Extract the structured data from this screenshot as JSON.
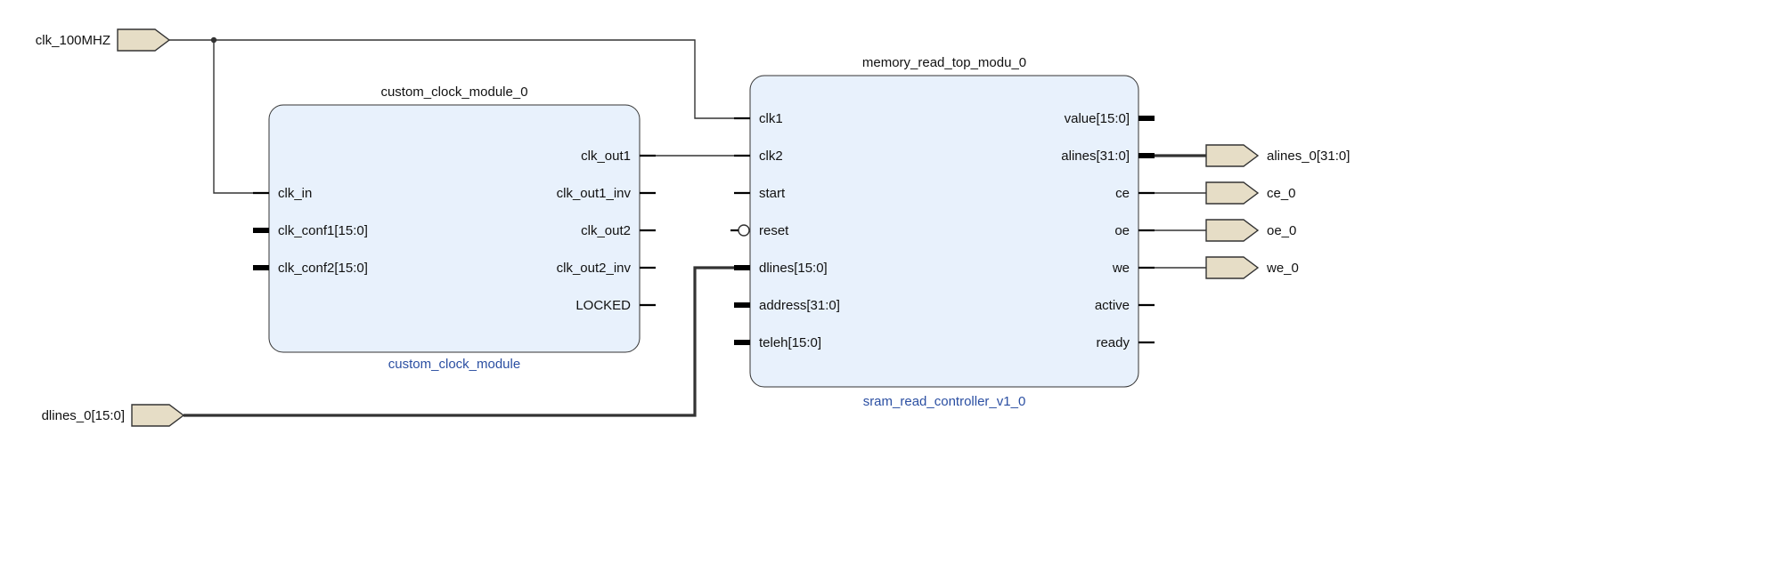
{
  "external_ports": {
    "clk_100mhz": "clk_100MHZ",
    "dlines_in": "dlines_0[15:0]",
    "alines_out": "alines_0[31:0]",
    "ce_out": "ce_0",
    "oe_out": "oe_0",
    "we_out": "we_0"
  },
  "blocks": {
    "clock": {
      "instance": "custom_clock_module_0",
      "type": "custom_clock_module",
      "inputs": {
        "clk_in": "clk_in",
        "clk_conf1": "clk_conf1[15:0]",
        "clk_conf2": "clk_conf2[15:0]"
      },
      "outputs": {
        "clk_out1": "clk_out1",
        "clk_out1_inv": "clk_out1_inv",
        "clk_out2": "clk_out2",
        "clk_out2_inv": "clk_out2_inv",
        "locked": "LOCKED"
      }
    },
    "mem": {
      "instance": "memory_read_top_modu_0",
      "type": "sram_read_controller_v1_0",
      "inputs": {
        "clk1": "clk1",
        "clk2": "clk2",
        "start": "start",
        "reset": "reset",
        "dlines": "dlines[15:0]",
        "address": "address[31:0]",
        "teleh": "teleh[15:0]"
      },
      "outputs": {
        "value": "value[15:0]",
        "alines": "alines[31:0]",
        "ce": "ce",
        "oe": "oe",
        "we": "we",
        "active": "active",
        "ready": "ready"
      }
    }
  },
  "chart_data": {
    "type": "diagram",
    "nodes": [
      {
        "id": "clk_100MHZ",
        "kind": "external_in",
        "width": 1
      },
      {
        "id": "dlines_0[15:0]",
        "kind": "external_in",
        "width": 16
      },
      {
        "id": "custom_clock_module_0",
        "kind": "block",
        "ip": "custom_clock_module",
        "in": [
          "clk_in",
          "clk_conf1[15:0]",
          "clk_conf2[15:0]"
        ],
        "out": [
          "clk_out1",
          "clk_out1_inv",
          "clk_out2",
          "clk_out2_inv",
          "LOCKED"
        ]
      },
      {
        "id": "memory_read_top_modu_0",
        "kind": "block",
        "ip": "sram_read_controller_v1_0",
        "in": [
          "clk1",
          "clk2",
          "start",
          "reset",
          "dlines[15:0]",
          "address[31:0]",
          "teleh[15:0]"
        ],
        "out": [
          "value[15:0]",
          "alines[31:0]",
          "ce",
          "oe",
          "we",
          "active",
          "ready"
        ]
      },
      {
        "id": "alines_0[31:0]",
        "kind": "external_out",
        "width": 32
      },
      {
        "id": "ce_0",
        "kind": "external_out",
        "width": 1
      },
      {
        "id": "oe_0",
        "kind": "external_out",
        "width": 1
      },
      {
        "id": "we_0",
        "kind": "external_out",
        "width": 1
      }
    ],
    "edges": [
      {
        "from": "clk_100MHZ",
        "to": "custom_clock_module_0.clk_in",
        "bus": false
      },
      {
        "from": "clk_100MHZ",
        "to": "memory_read_top_modu_0.clk1",
        "bus": false
      },
      {
        "from": "custom_clock_module_0.clk_out1",
        "to": "memory_read_top_modu_0.clk2",
        "bus": false
      },
      {
        "from": "dlines_0[15:0]",
        "to": "memory_read_top_modu_0.dlines[15:0]",
        "bus": true
      },
      {
        "from": "memory_read_top_modu_0.alines[31:0]",
        "to": "alines_0[31:0]",
        "bus": true
      },
      {
        "from": "memory_read_top_modu_0.ce",
        "to": "ce_0",
        "bus": false
      },
      {
        "from": "memory_read_top_modu_0.oe",
        "to": "oe_0",
        "bus": false
      },
      {
        "from": "memory_read_top_modu_0.we",
        "to": "we_0",
        "bus": false
      }
    ]
  }
}
